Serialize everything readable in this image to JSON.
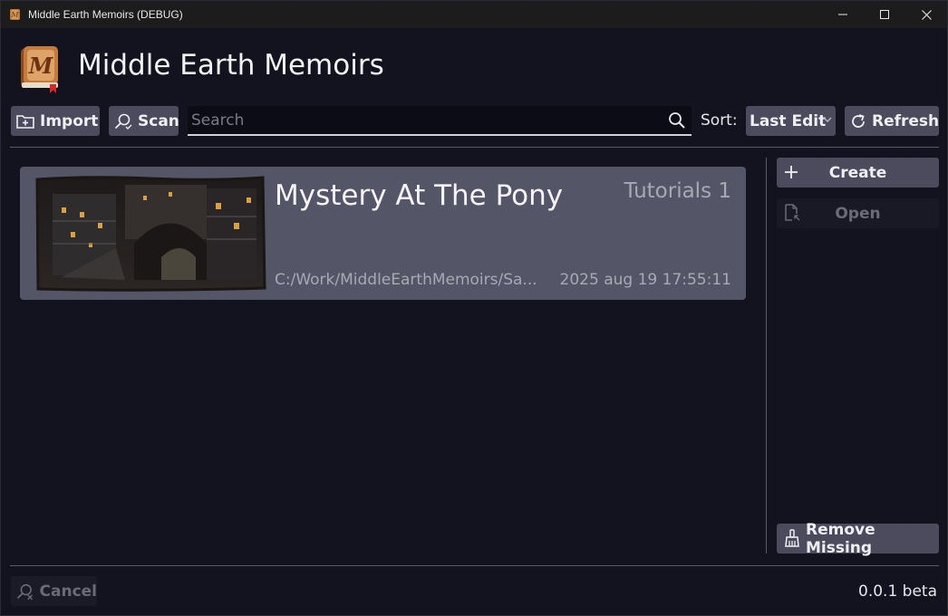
{
  "window": {
    "title": "Middle Earth Memoirs (DEBUG)",
    "controls": [
      "minimize-icon",
      "maximize-icon",
      "close-icon"
    ]
  },
  "header": {
    "app_title": "Middle Earth Memoirs",
    "logo_letter": "M"
  },
  "toolbar": {
    "import_label": "Import",
    "scan_label": "Scan",
    "search_placeholder": "Search",
    "search_value": "",
    "sort_label": "Sort:",
    "sort_value": "Last Edit",
    "refresh_label": "Refresh"
  },
  "projects": [
    {
      "title": "Mystery At The Pony",
      "category": "Tutorials 1",
      "path": "C:/Work/MiddleEarthMemoirs/Sa...",
      "last_edit": "2025 aug 19 17:55:11"
    }
  ],
  "side_panel": {
    "create_label": "Create",
    "open_label": "Open",
    "remove_missing_label": "Remove Missing"
  },
  "footer": {
    "cancel_label": "Cancel",
    "version": "0.0.1 beta"
  },
  "colors": {
    "background": "#13131f",
    "button": "#4b4b5d",
    "card": "#555568",
    "disabled_text": "#6b6b77",
    "muted_text": "#a9a9b4"
  }
}
